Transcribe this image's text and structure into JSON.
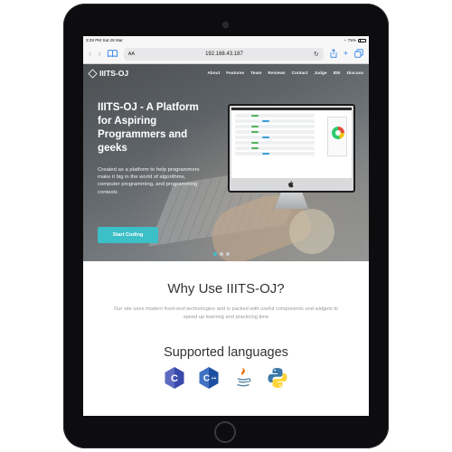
{
  "status": {
    "time": "3:28 PM",
    "date": "Sat 28 Mar",
    "battery": "75%"
  },
  "browser": {
    "text_size": "AA",
    "url": "192.168.43.187"
  },
  "site": {
    "brand": "IIITS-OJ",
    "nav": [
      "About",
      "Features",
      "Team",
      "Reviews",
      "Contact",
      "Judge",
      "IDE",
      "Discuss"
    ]
  },
  "hero": {
    "title": "IIITS-OJ - A Platform for Aspiring Programmers and geeks",
    "description": "Created as a platform to help programmers make it big in the world of algorithms, computer programming, and programming contests",
    "cta": "Start Coding",
    "slides": 3,
    "active_slide": 1
  },
  "why": {
    "title": "Why Use IIITS-OJ?",
    "description": "Our site uses modern front-end technologies and is packed with useful components and widgets to speed up learning and practicing time"
  },
  "languages": {
    "title": "Supported languages",
    "items": [
      "C",
      "C++",
      "Java",
      "Python"
    ]
  },
  "colors": {
    "accent": "#3cbfc7",
    "ios_blue": "#2f80ed"
  }
}
